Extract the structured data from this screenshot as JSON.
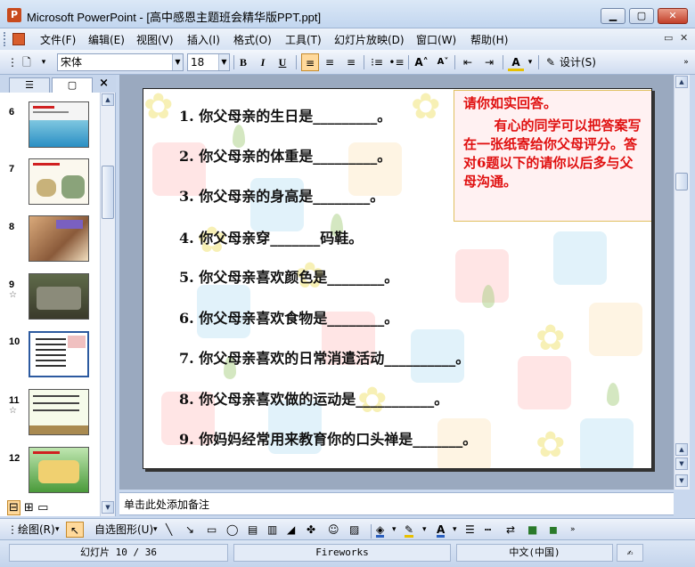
{
  "window": {
    "title": "Microsoft PowerPoint - [高中感恩主题班会精华版PPT.ppt]",
    "app_icon": "powerpoint-icon"
  },
  "menu": {
    "items": [
      "文件(F)",
      "编辑(E)",
      "视图(V)",
      "插入(I)",
      "格式(O)",
      "工具(T)",
      "幻灯片放映(D)",
      "窗口(W)",
      "帮助(H)"
    ]
  },
  "toolbar": {
    "font_name": "宋体",
    "font_size": "18",
    "bold": "B",
    "italic": "I",
    "underline": "U",
    "design_label": "设计(S)"
  },
  "left_panel": {
    "slides": [
      {
        "number": "6",
        "has_star": false
      },
      {
        "number": "7",
        "has_star": false
      },
      {
        "number": "8",
        "has_star": false
      },
      {
        "number": "9",
        "has_star": true
      },
      {
        "number": "10",
        "has_star": false
      },
      {
        "number": "11",
        "has_star": true
      },
      {
        "number": "12",
        "has_star": false
      }
    ]
  },
  "slide": {
    "questions": [
      "1. 你父母亲的生日是_________。",
      "2. 你父母亲的体重是_________。",
      "3. 你父母亲的身高是________。",
      "4. 你父母亲穿_______码鞋。",
      "5. 你父母亲喜欢颜色是________。",
      "6. 你父母亲喜欢食物是________。",
      "7. 你父母亲喜欢的日常消遣活动__________。",
      "8. 你父母亲喜欢做的运动是___________。",
      "9. 你妈妈经常用来教育你的口头禅是_______。"
    ],
    "note_title": "请你如实回答。",
    "note_body": "有心的同学可以把答案写在一张纸寄给你父母评分。答对6题以下的请你以后多与父母沟通。"
  },
  "notes_placeholder": "单击此处添加备注",
  "drawing_toolbar": {
    "draw_label": "绘图(R)",
    "autoshapes_label": "自选图形(U)"
  },
  "status": {
    "slide_info": "幻灯片 10 / 36",
    "design_name": "Fireworks",
    "language": "中文(中国)"
  }
}
